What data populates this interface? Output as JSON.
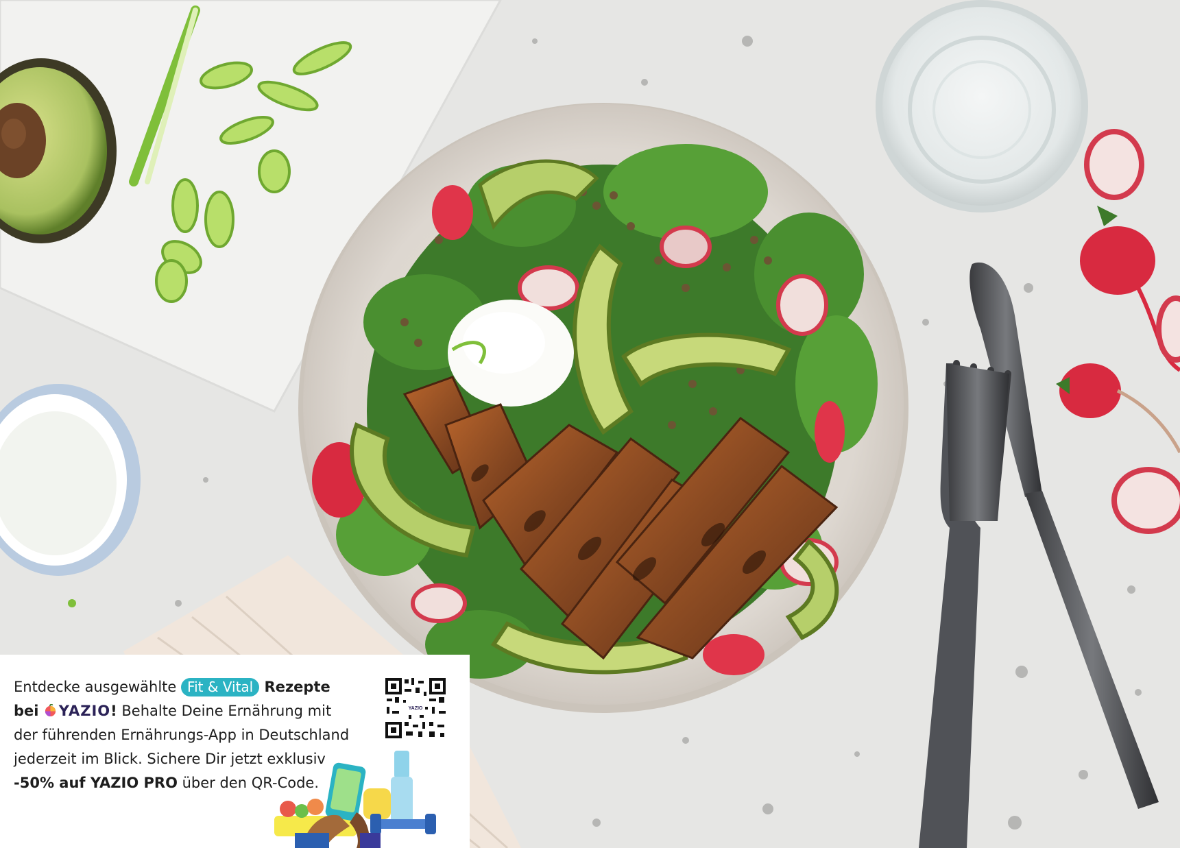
{
  "promo": {
    "intro": "Entdecke ausgewählte ",
    "tag": "Fit & Vital",
    "rezepte": " Rezepte",
    "bei": "bei ",
    "brand": "YAZIO",
    "bang": "!",
    "body": " Behalte Deine Ernährung mit der führenden Ernährungs-App in Deutschland jederzeit im Blick. Sichere Dir jetzt exklusiv ",
    "offer": "-50% auf YAZIO PRO",
    "outro": " über den QR-Code.",
    "qr_center_label": "YAZIO"
  },
  "colors": {
    "countertop": "#e6e6e4",
    "accent_teal": "#2bb3c3",
    "brand_navy": "#2b2257"
  }
}
